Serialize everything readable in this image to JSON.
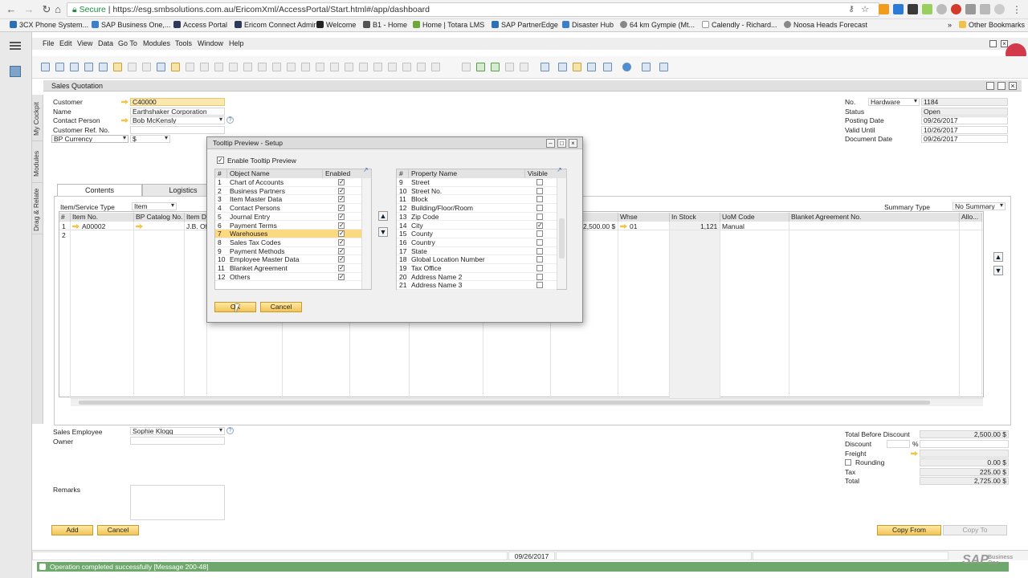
{
  "browser": {
    "secure_label": "Secure",
    "url": "https://esg.smbsolutions.com.au/EricomXml/AccessPortal/Start.html#/app/dashboard",
    "bookmarks": [
      "3CX Phone System...",
      "SAP Business One,...",
      "Access Portal",
      "Ericom Connect Admir",
      "Welcome",
      "B1 - Home",
      "Home | Totara LMS",
      "SAP PartnerEdge",
      "Disaster Hub",
      "64 km Gympie (Mt...",
      "Calendly - Richard...",
      "Noosa Heads Forecast"
    ],
    "other_bookmarks": "Other Bookmarks"
  },
  "menu": [
    "File",
    "Edit",
    "View",
    "Data",
    "Go To",
    "Modules",
    "Tools",
    "Window",
    "Help"
  ],
  "side_tabs": [
    "My Cockpit",
    "Modules",
    "Drag & Relate"
  ],
  "window_title": "Sales Quotation",
  "header": {
    "customer_label": "Customer",
    "customer_value": "C40000",
    "name_label": "Name",
    "name_value": "Earthshaker Corporation",
    "contact_label": "Contact Person",
    "contact_value": "Bob McKensly",
    "ref_label": "Customer Ref. No.",
    "currency_label": "BP Currency",
    "currency_value": "$",
    "no_label": "No.",
    "series_value": "Hardware",
    "no_value": "1184",
    "status_label": "Status",
    "status_value": "Open",
    "posting_label": "Posting Date",
    "posting_value": "09/26/2017",
    "valid_label": "Valid Until",
    "valid_value": "10/26/2017",
    "docdate_label": "Document Date",
    "docdate_value": "09/26/2017"
  },
  "tabs": [
    "Contents",
    "Logistics"
  ],
  "item_type_label": "Item/Service Type",
  "item_type_value": "Item",
  "summary_type_label": "Summary Type",
  "summary_type_value": "No Summary",
  "grid": {
    "headers": [
      "#",
      "Item No.",
      "BP Catalog No.",
      "Item D",
      "Whse",
      "In Stock",
      "UoM Code",
      "Blanket Agreement No.",
      "Allo..."
    ],
    "row": {
      "num": "1",
      "item": "A00002",
      "desc": "J.B. Of",
      "total": "2,500.00 $",
      "whse": "01",
      "stock": "1,121",
      "uom": "Manual"
    },
    "row2_num": "2"
  },
  "footer": {
    "sales_emp_label": "Sales Employee",
    "sales_emp_value": "Sophie Klogg",
    "owner_label": "Owner",
    "remarks_label": "Remarks",
    "add_btn": "Add",
    "cancel_btn": "Cancel",
    "total_before_label": "Total Before Discount",
    "total_before_value": "2,500.00 $",
    "discount_label": "Discount",
    "percent": "%",
    "freight_label": "Freight",
    "rounding_label": "Rounding",
    "rounding_value": "0.00 $",
    "tax_label": "Tax",
    "tax_value": "225.00 $",
    "total_label": "Total",
    "total_value": "2,725.00 $",
    "copy_from": "Copy From",
    "copy_to": "Copy To"
  },
  "dialog": {
    "title": "Tooltip Preview - Setup",
    "enable_label": "Enable Tooltip Preview",
    "left_headers": [
      "#",
      "Object Name",
      "Enabled"
    ],
    "left_rows": [
      [
        "1",
        "Chart of Accounts"
      ],
      [
        "2",
        "Business Partners"
      ],
      [
        "3",
        "Item Master Data"
      ],
      [
        "4",
        "Contact Persons"
      ],
      [
        "5",
        "Journal Entry"
      ],
      [
        "6",
        "Payment Terms"
      ],
      [
        "7",
        "Warehouses"
      ],
      [
        "8",
        "Sales Tax Codes"
      ],
      [
        "9",
        "Payment Methods"
      ],
      [
        "10",
        "Employee Master Data"
      ],
      [
        "11",
        "Blanket Agreement"
      ],
      [
        "12",
        "Others"
      ]
    ],
    "right_headers": [
      "#",
      "Property Name",
      "Visible"
    ],
    "right_rows": [
      [
        "9",
        "Street"
      ],
      [
        "10",
        "Street No."
      ],
      [
        "11",
        "Block"
      ],
      [
        "12",
        "Building/Floor/Room"
      ],
      [
        "13",
        "Zip Code"
      ],
      [
        "14",
        "City"
      ],
      [
        "15",
        "County"
      ],
      [
        "16",
        "Country"
      ],
      [
        "17",
        "State"
      ],
      [
        "18",
        "Global Location Number"
      ],
      [
        "19",
        "Tax Office"
      ],
      [
        "20",
        "Address Name 2"
      ],
      [
        "21",
        "Address Name 3"
      ]
    ],
    "ok": "OK",
    "cancel": "Cancel"
  },
  "status": {
    "date": "09/26/2017",
    "message": "Operation completed successfully  [Message 200-48]",
    "brand": "SAP",
    "brand_sub": "Business One"
  }
}
